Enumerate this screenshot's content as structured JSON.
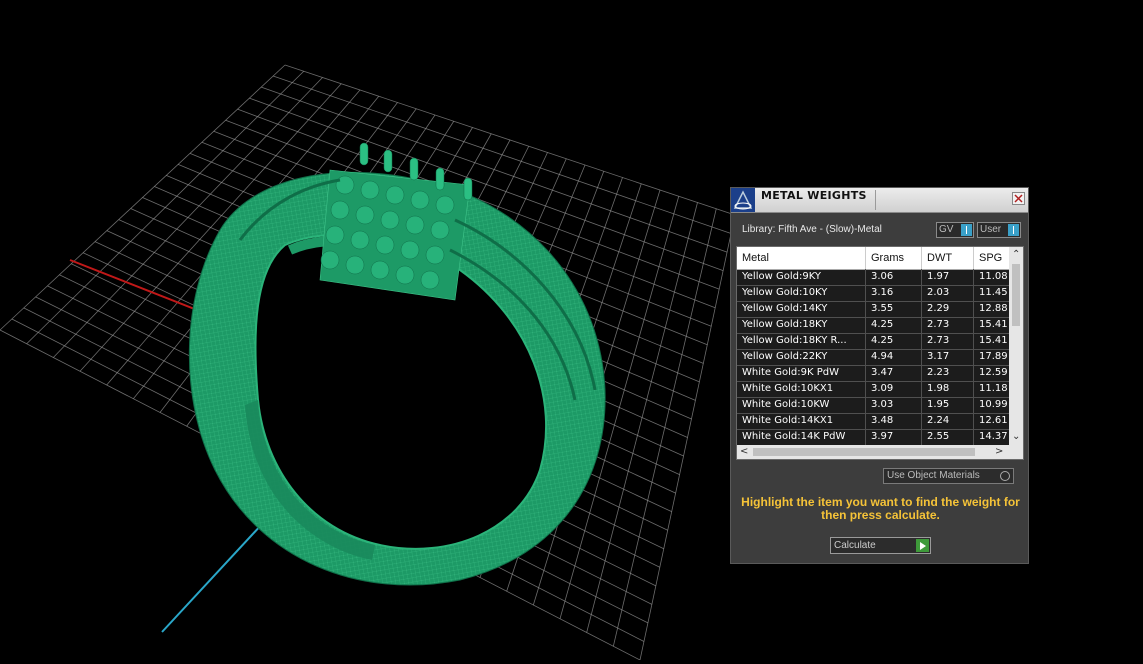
{
  "panel": {
    "title": "METAL WEIGHTS",
    "library_label": "Library: Fifth Ave - (Slow)-Metal",
    "gv_select": "GV",
    "user_select": "User",
    "use_object_materials": "Use Object Materials",
    "hint": "Highlight the item you want to find the weight for then press calculate.",
    "calculate_label": "Calculate",
    "accent_color": "#f5c338"
  },
  "table": {
    "columns": [
      "Metal",
      "Grams",
      "DWT",
      "SPG"
    ],
    "rows": [
      {
        "metal": "Yellow Gold:9KY",
        "grams": "3.06",
        "dwt": "1.97",
        "spg": "11.08"
      },
      {
        "metal": "Yellow Gold:10KY",
        "grams": "3.16",
        "dwt": "2.03",
        "spg": "11.45"
      },
      {
        "metal": "Yellow Gold:14KY",
        "grams": "3.55",
        "dwt": "2.29",
        "spg": "12.88"
      },
      {
        "metal": "Yellow Gold:18KY",
        "grams": "4.25",
        "dwt": "2.73",
        "spg": "15.41"
      },
      {
        "metal": "Yellow Gold:18KY R...",
        "grams": "4.25",
        "dwt": "2.73",
        "spg": "15.41"
      },
      {
        "metal": "Yellow Gold:22KY",
        "grams": "4.94",
        "dwt": "3.17",
        "spg": "17.89"
      },
      {
        "metal": "White Gold:9K PdW",
        "grams": "3.47",
        "dwt": "2.23",
        "spg": "12.59"
      },
      {
        "metal": "White Gold:10KX1",
        "grams": "3.09",
        "dwt": "1.98",
        "spg": "11.18"
      },
      {
        "metal": "White Gold:10KW",
        "grams": "3.03",
        "dwt": "1.95",
        "spg": "10.99"
      },
      {
        "metal": "White Gold:14KX1",
        "grams": "3.48",
        "dwt": "2.24",
        "spg": "12.61"
      },
      {
        "metal": "White Gold:14K PdW",
        "grams": "3.97",
        "dwt": "2.55",
        "spg": "14.37"
      }
    ]
  },
  "viewport": {
    "model_color": "#1f9a66",
    "grid_color": "#9a9a9a",
    "x_axis_color": "#c01818",
    "y_axis_color": "#2aa7c9"
  }
}
